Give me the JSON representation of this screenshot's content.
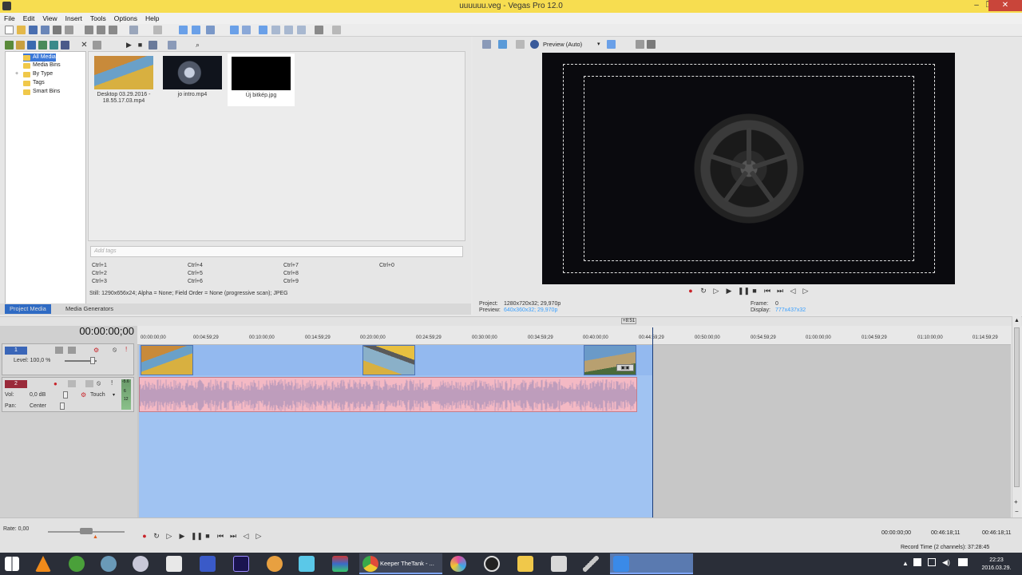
{
  "window": {
    "title": "uuuuuu.veg - Vegas Pro 12.0",
    "minimize": "–",
    "maximize": "❐",
    "close": "✕"
  },
  "menu": [
    "File",
    "Edit",
    "View",
    "Insert",
    "Tools",
    "Options",
    "Help"
  ],
  "tree": {
    "items": [
      {
        "label": "All Media",
        "selected": true
      },
      {
        "label": "Media Bins"
      },
      {
        "label": "By Type"
      },
      {
        "label": "Tags"
      },
      {
        "label": "Smart Bins"
      }
    ]
  },
  "media": {
    "items": [
      {
        "label": "Desktop 03.29.2016 -\n18.55.17.03.mp4"
      },
      {
        "label": "jo intro.mp4"
      },
      {
        "label": "Új bitkép.jpg"
      }
    ],
    "tags_placeholder": "Add tags",
    "shortcuts": [
      "Ctrl+1",
      "Ctrl+4",
      "Ctrl+7",
      "Ctrl+0",
      "Ctrl+2",
      "Ctrl+5",
      "Ctrl+8",
      "Ctrl+3",
      "Ctrl+6",
      "Ctrl+9"
    ],
    "still_info": "Still: 1290x656x24; Alpha = None; Field Order = None (progressive scan); JPEG",
    "tabs": [
      {
        "label": "Project Media",
        "active": true
      },
      {
        "label": "Media Generators"
      }
    ]
  },
  "preview": {
    "mode": "Preview (Auto)",
    "project_label": "Project:",
    "project_value": "1280x720x32; 29,970p",
    "preview_label": "Preview:",
    "preview_value": "640x360x32; 29,970p",
    "frame_label": "Frame:",
    "frame_value": "0",
    "display_label": "Display:",
    "display_value": "777x437x32"
  },
  "timeline": {
    "timecode": "00:00:00;00",
    "ruler_labels": [
      "00:00:00;00",
      "00:04:59;29",
      "00:10:00;00",
      "00:14:59;29",
      "00:20:00;00",
      "00:24:59;29",
      "00:30:00;00",
      "00:34:59;29",
      "00:40:00;00",
      "00:44:59;29",
      "00:50:00;00",
      "00:54:59;29",
      "01:00:00;00",
      "01:04:59;29",
      "01:10:00;00",
      "01:14:59;29"
    ],
    "end_marker": "+8:51",
    "video_track": {
      "num": "1",
      "level_label": "Level: 100,0 %"
    },
    "audio_track": {
      "num": "2",
      "vol_label": "Vol:",
      "vol_value": "0,0 dB",
      "pan_label": "Pan:",
      "pan_value": "Center",
      "mode": "Touch",
      "meter_top": "-5.6",
      "meter_a": "6",
      "meter_b": "12"
    }
  },
  "bottom": {
    "rate": "Rate: 0,00",
    "tc1": "00:00:00;00",
    "tc2": "00:46:18;11",
    "tc3": "00:46:18;11",
    "record_time": "Record Time (2 channels): 37:28:45"
  },
  "taskbar": {
    "chrome_title": "Keeper TheTank - ...",
    "clock_time": "22:23",
    "clock_date": "2016.03.29."
  },
  "colors": {
    "title_bg": "#f7dd50",
    "accent": "#2f6bc4",
    "audio_clip": "#f4b9c4",
    "selection": "#a0c3f2"
  }
}
